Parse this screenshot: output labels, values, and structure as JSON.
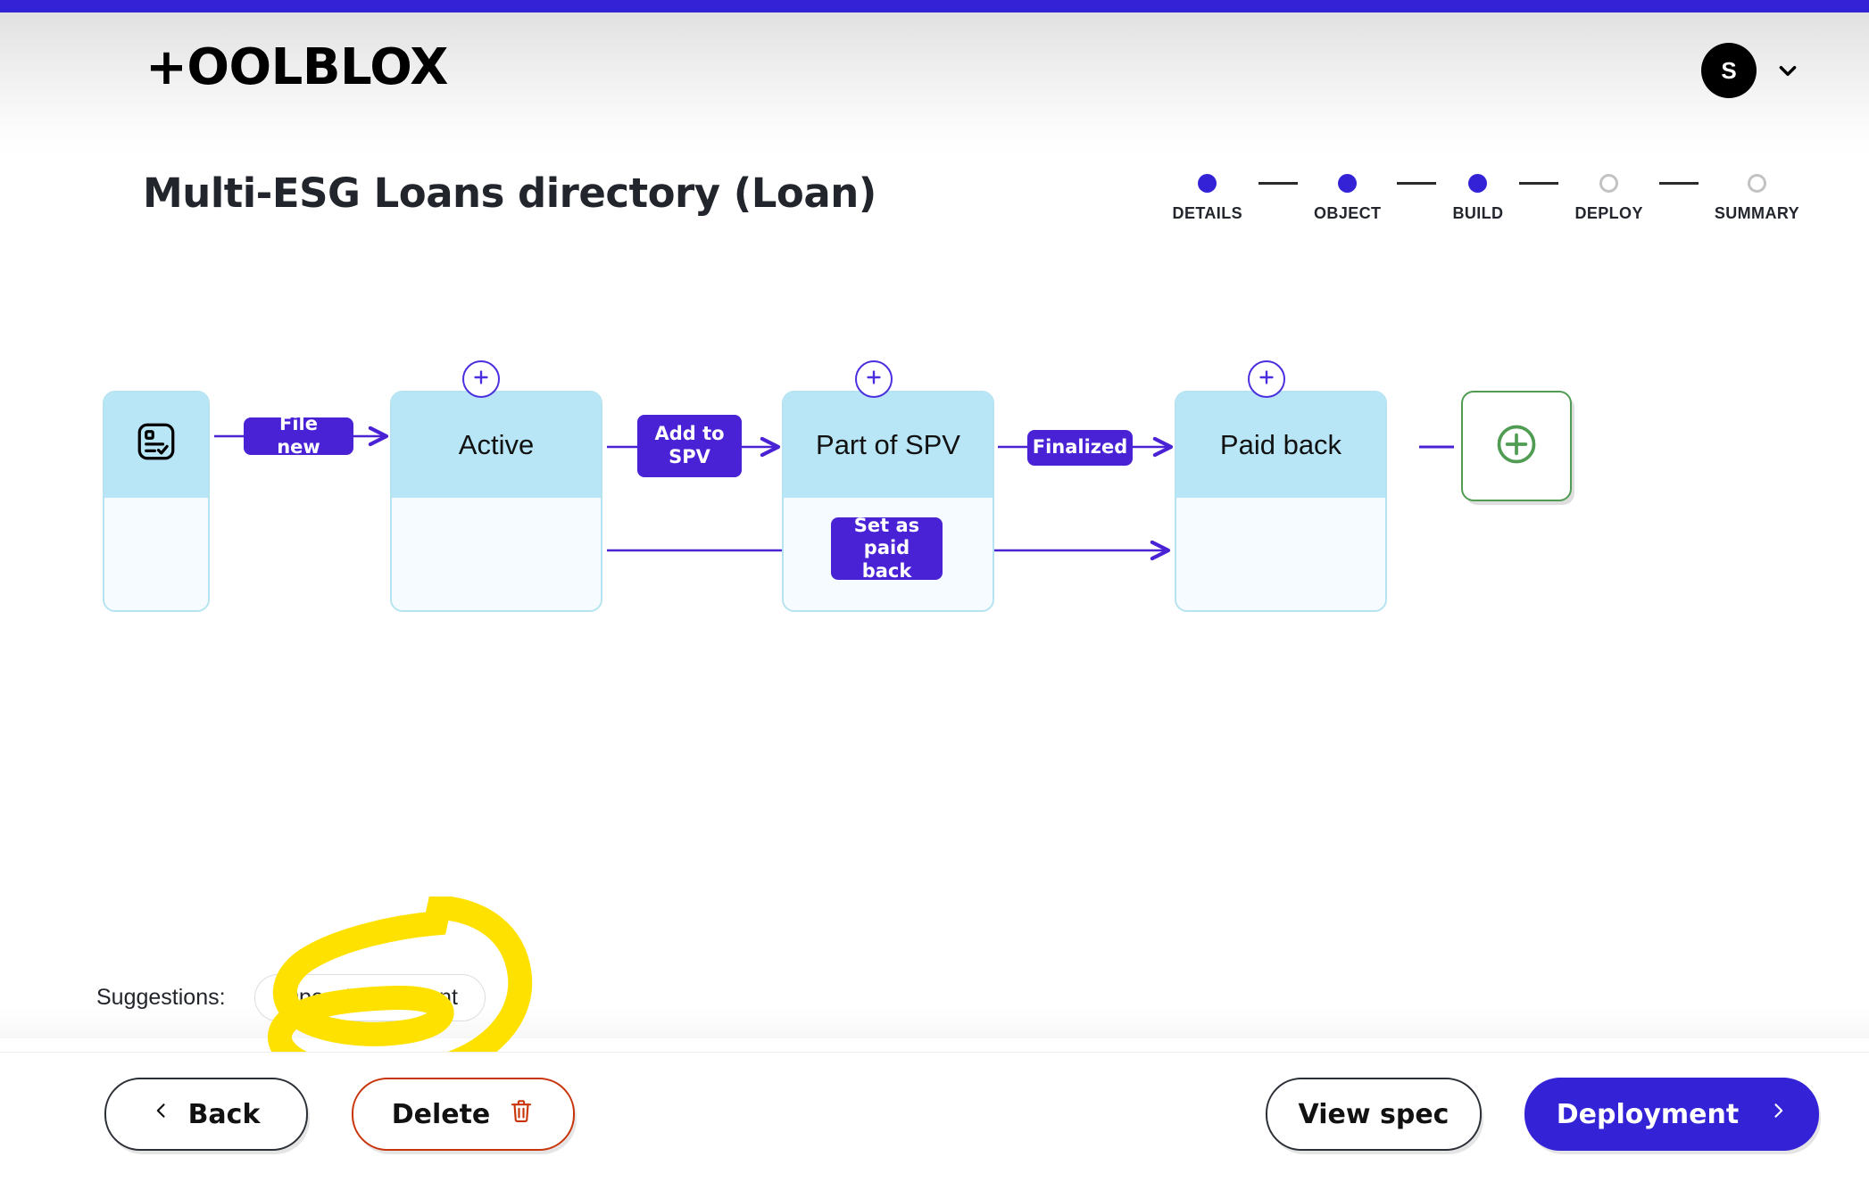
{
  "theme": {
    "accent": "#3423d6",
    "pill": "#4a22d6",
    "node_head": "#b8e6f6",
    "node_body": "#f5fbfe",
    "node_border": "#b6e3f1",
    "add_green": "#4f9c52",
    "delete_red": "#c9350b",
    "highlight_yellow": "#ffe100"
  },
  "header": {
    "brand": "+OOLBLOX",
    "avatar_initial": "S",
    "avatar_chevron_icon": "chevron-down-icon"
  },
  "page": {
    "title": "Multi-ESG Loans directory (Loan)"
  },
  "stepper": {
    "steps": [
      {
        "label": "DETAILS",
        "state": "done"
      },
      {
        "label": "OBJECT",
        "state": "done"
      },
      {
        "label": "BUILD",
        "state": "done"
      },
      {
        "label": "DEPLOY",
        "state": "todo"
      },
      {
        "label": "SUMMARY",
        "state": "todo"
      }
    ]
  },
  "workflow": {
    "start_node": {
      "icon": "document-checklist-icon"
    },
    "states": [
      {
        "label": "Active",
        "add_icon": "plus-circle-icon"
      },
      {
        "label": "Part of SPV",
        "add_icon": "plus-circle-icon"
      },
      {
        "label": "Paid back",
        "add_icon": "plus-circle-icon"
      }
    ],
    "transitions": [
      {
        "label": "File new",
        "from": "start",
        "to": "Active"
      },
      {
        "label": "Add to\nSPV",
        "from": "Active",
        "to": "Part of SPV"
      },
      {
        "label": "Finalized",
        "from": "Part of SPV",
        "to": "Paid back"
      },
      {
        "label": "Set as\npaid back",
        "from": "Active",
        "to": "Paid back"
      }
    ],
    "transition_labels": {
      "file_new": "File new",
      "add_to_spv_line1": "Add to",
      "add_to_spv_line2": "SPV",
      "finalized": "Finalized",
      "set_as_paid_back_line1": "Set as",
      "set_as_paid_back_line2": "paid back"
    },
    "add_state_button": {
      "icon": "plus-circle-outline-icon"
    }
  },
  "suggestions": {
    "label": "Suggestions:",
    "chips": [
      "Open AI Assistant"
    ],
    "annotation": "hand-drawn yellow highlighter loop circling the Open AI Assistant chip"
  },
  "footer": {
    "back_label": "Back",
    "back_icon": "chevron-left-icon",
    "delete_label": "Delete",
    "delete_icon": "trash-icon",
    "view_spec_label": "View spec",
    "deployment_label": "Deployment",
    "deployment_icon": "chevron-right-icon"
  }
}
